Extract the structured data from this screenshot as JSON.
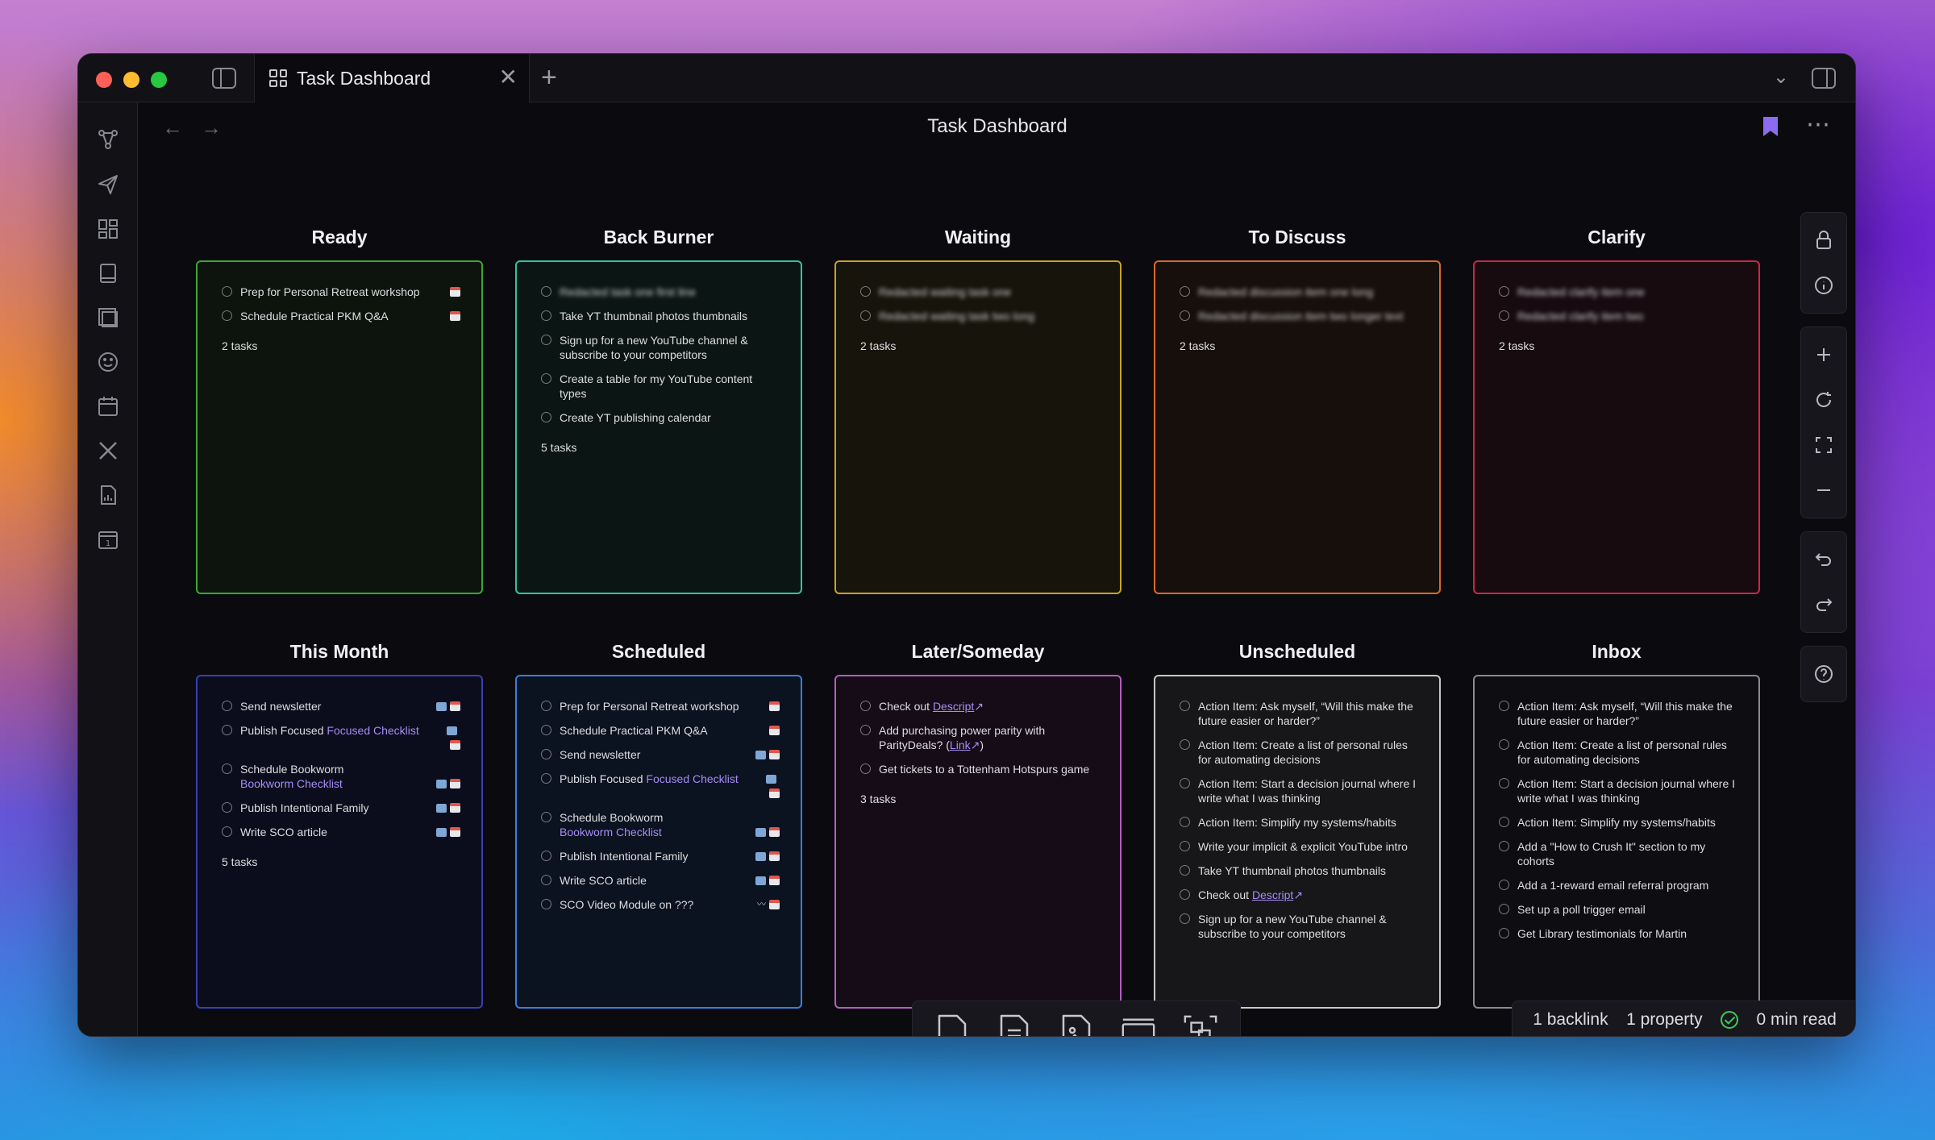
{
  "tab": {
    "title": "Task Dashboard",
    "close": "✕",
    "add": "+"
  },
  "view": {
    "title": "Task Dashboard",
    "back": "←",
    "forward": "→",
    "more": "⋯"
  },
  "status": {
    "backlinks": "1 backlink",
    "properties": "1 property",
    "read_time": "0 min read"
  },
  "colors": {
    "ready": "#3aa734",
    "back_burner": "#2ec5a0",
    "waiting": "#c9a227",
    "to_discuss": "#d86a2a",
    "clarify": "#c8284a",
    "this_month": "#3a3fb5",
    "scheduled": "#3b7ee0",
    "later_someday": "#b65dc0",
    "unscheduled": "#c8c8c8",
    "inbox": "#8a8a92",
    "link": "#a58cf6"
  },
  "columns": {
    "ready": {
      "title": "Ready",
      "tasks": [
        "Prep for Personal Retreat workshop",
        "Schedule Practical PKM Q&A"
      ],
      "count": "2 tasks"
    },
    "back_burner": {
      "title": "Back Burner",
      "tasks": [
        "Redacted task one first line",
        "Take YT thumbnail photos thumbnails",
        "Sign up for a new YouTube channel & subscribe to your competitors",
        "Create a table for my YouTube content types",
        "Create YT publishing calendar"
      ],
      "count": "5 tasks"
    },
    "waiting": {
      "title": "Waiting",
      "tasks": [
        "Redacted waiting task one",
        "Redacted waiting task two long"
      ],
      "count": "2 tasks"
    },
    "to_discuss": {
      "title": "To Discuss",
      "tasks": [
        "Redacted discussion item one long",
        "Redacted discussion item two longer text"
      ],
      "count": "2 tasks"
    },
    "clarify": {
      "title": "Clarify",
      "tasks": [
        "Redacted clarify item one",
        "Redacted clarify item two"
      ],
      "count": "2 tasks"
    },
    "this_month": {
      "title": "This Month",
      "tasks": [
        "Send newsletter",
        "Publish Focused",
        "Focused Checklist",
        "Schedule Bookworm",
        "Bookworm Checklist",
        "Publish Intentional Family",
        "Write SCO article"
      ],
      "count": "5 tasks"
    },
    "scheduled": {
      "title": "Scheduled",
      "tasks": [
        "Prep for Personal Retreat workshop",
        "Schedule Practical PKM Q&A",
        "Send newsletter",
        "Publish Focused",
        "Focused Checklist",
        "Schedule Bookworm",
        "Bookworm Checklist",
        "Publish Intentional Family",
        "Write SCO article",
        "SCO Video Module on ???"
      ],
      "count": ""
    },
    "later_someday": {
      "title": "Later/Someday",
      "tasks": [
        "Check out",
        "Descript",
        "Add purchasing power parity with ParityDeals? (",
        "Link",
        ")",
        "Get tickets to a Tottenham Hotspurs game"
      ],
      "count": "3 tasks"
    },
    "unscheduled": {
      "title": "Unscheduled",
      "tasks": [
        "Action Item: Ask myself, “Will this make the future easier or harder?”",
        "Action Item: Create a list of personal rules for automating decisions",
        "Action Item: Start a decision journal where I write what I was thinking",
        "Action Item: Simplify my systems/habits",
        "Write your implicit & explicit YouTube intro",
        "Take YT thumbnail photos thumbnails",
        "Check out",
        "Descript",
        "Sign up for a new YouTube channel & subscribe to your competitors"
      ],
      "count": ""
    },
    "inbox": {
      "title": "Inbox",
      "tasks": [
        "Action Item: Ask myself, “Will this make the future easier or harder?”",
        "Action Item: Create a list of personal rules for automating decisions",
        "Action Item: Start a decision journal where I write what I was thinking",
        "Action Item: Simplify my systems/habits",
        "Add a \"How to Crush It\" section to my cohorts",
        "Add a 1-reward email referral program",
        "Set up a poll trigger email",
        "Get Library testimonials for Martin"
      ],
      "count": ""
    }
  },
  "ribbon_icons": [
    "graph-icon",
    "send-icon",
    "dashboard-icon",
    "book-icon",
    "layers-icon",
    "smiley-icon",
    "calendar-icon",
    "tools-icon",
    "report-icon",
    "daily-note-icon"
  ],
  "right_tools": [
    "lock-icon",
    "info-icon",
    "zoom-in-icon",
    "reset-icon",
    "fullscreen-icon",
    "zoom-out-icon",
    "undo-icon",
    "redo-icon",
    "help-icon"
  ],
  "bottom_tools": [
    "new-note-icon",
    "new-document-icon",
    "image-icon",
    "card-icon",
    "group-icon"
  ]
}
